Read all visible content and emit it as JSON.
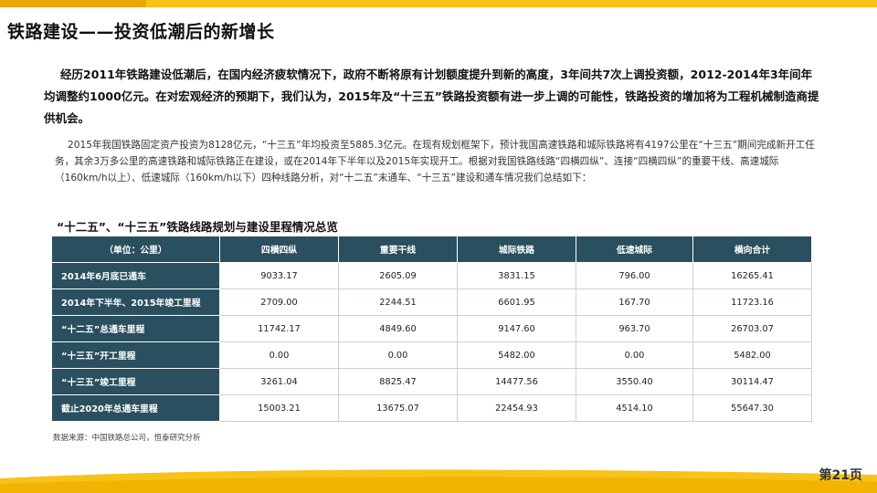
{
  "slide": {
    "title": "铁路建设——投资低潮后的新增长",
    "lead": "经历2011年铁路建设低潮后，在国内经济疲软情况下，政府不断将原有计划额度提升到新的高度，3年间共7次上调投资额，2012-2014年3年间年均调整约1000亿元。在对宏观经济的预期下，我们认为，2015年及“十三五”铁路投资额有进一步上调的可能性，铁路投资的增加将为工程机械制造商提供机会。",
    "body": "2015年我国铁路固定资产投资为8128亿元，“十三五”年均投资至5885.3亿元。在现有规划框架下，预计我国高速铁路和城际铁路将有4197公里在“十三五”期间完成新开工任务，其余3万多公里的高速铁路和城际铁路正在建设，或在2014年下半年以及2015年实现开工。根据对我国铁路线路“四横四纵”、连接“四横四纵”的重要干线、高速城际（160km/h以上）、低速城际（160km/h以下）四种线路分析，对“十二五”末通车、“十三五”建设和通车情况我们总结如下：",
    "table_title": "“十二五”、“十三五”铁路线路规划与建设里程情况总览",
    "source": "数据来源：中国铁路总公司，恒泰研究分析",
    "page": "第21页"
  },
  "table": {
    "headers": [
      "（单位：公里）",
      "四横四纵",
      "重要干线",
      "城际铁路",
      "低速城际",
      "横向合计"
    ],
    "rows": [
      {
        "label": "2014年6月底已通车",
        "cells": [
          "9033.17",
          "2605.09",
          "3831.15",
          "796.00",
          "16265.41"
        ]
      },
      {
        "label": "2014年下半年、2015年竣工里程",
        "cells": [
          "2709.00",
          "2244.51",
          "6601.95",
          "167.70",
          "11723.16"
        ]
      },
      {
        "label": "“十二五”总通车里程",
        "cells": [
          "11742.17",
          "4849.60",
          "9147.60",
          "963.70",
          "26703.07"
        ]
      },
      {
        "label": "“十三五”开工里程",
        "cells": [
          "0.00",
          "0.00",
          "5482.00",
          "0.00",
          "5482.00"
        ]
      },
      {
        "label": "“十三五”竣工里程",
        "cells": [
          "3261.04",
          "8825.47",
          "14477.56",
          "3550.40",
          "30114.47"
        ]
      },
      {
        "label": "截止2020年总通车里程",
        "cells": [
          "15003.21",
          "13675.07",
          "22454.93",
          "4514.10",
          "55647.30"
        ]
      }
    ]
  },
  "colors": {
    "accent": "#f7c21a",
    "table_header": "#2a4f5e"
  }
}
